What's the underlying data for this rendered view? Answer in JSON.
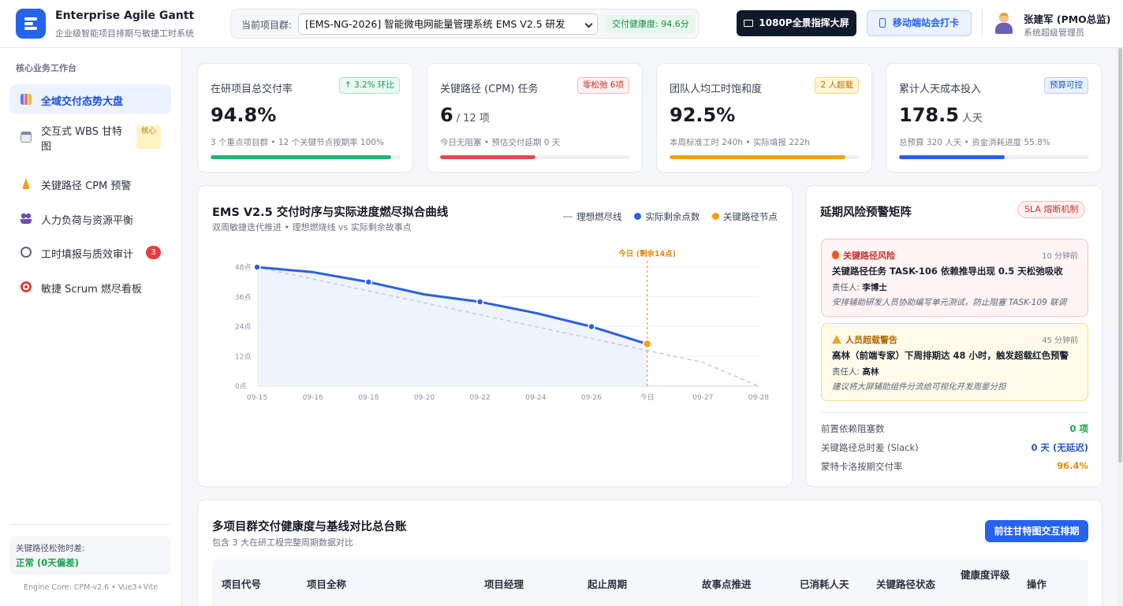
{
  "header": {
    "brand_title": "Enterprise Agile Gantt",
    "brand_subtitle": "企业级智能项目排期与敏捷工时系统",
    "project_label": "当前项目群:",
    "project_selected": "[EMS-NG-2026] 智能微电网能量管理系统 EMS V2.5 研发",
    "health_badge": "交付健康度: 94.6分",
    "bigscreen_button": "1080P全景指挥大屏",
    "mobile_button": "移动端站会打卡",
    "user_name": "张建军 (PMO总监)",
    "user_role": "系统超级管理员"
  },
  "sidebar": {
    "section_title": "核心业务工作台",
    "items": [
      {
        "label": "全域交付态势大盘",
        "active": true,
        "icon": "chart-icon"
      },
      {
        "label": "交互式 WBS 甘特图",
        "tag": "核心",
        "icon": "calendar-icon"
      },
      {
        "label": "关键路径 CPM 预警",
        "icon": "lightning-icon"
      },
      {
        "label": "人力负荷与资源平衡",
        "icon": "people-icon"
      },
      {
        "label": "工时填报与质效审计",
        "count": "3",
        "icon": "stopwatch-icon"
      },
      {
        "label": "敏捷 Scrum 燃尽看板",
        "icon": "target-icon"
      }
    ],
    "slack_label": "关键路径松弛时差:",
    "slack_value": "正常 (0天偏差)",
    "engine": "Engine Core: CPM-v2.6 • Vue3+Vite"
  },
  "kpis": [
    {
      "title": "在研项目总交付率",
      "badge": "↑ 3.2% 环比",
      "value": "94.8%",
      "unit": "",
      "note": "3 个重点项目群 • 12 个关键节点按期率 100%",
      "progress": 0.95,
      "color": "#1fb573",
      "badge_bg": "#eafaf1",
      "badge_fg": "#16915a",
      "badge_border": "#a7e5c4"
    },
    {
      "title": "关键路径 (CPM) 任务",
      "badge": "零松弛 6项",
      "value": "6",
      "unit": "/ 12 项",
      "note": "今日无阻塞 • 预估交付延期 0 天",
      "progress": 0.5,
      "color": "#e5484d",
      "badge_bg": "#fff1f1",
      "badge_fg": "#cf2d2d",
      "badge_border": "#f6b8b8"
    },
    {
      "title": "团队人均工时饱和度",
      "badge": "2 人超载",
      "value": "92.5%",
      "unit": "",
      "note": "本周标准工时 240h • 实际填报 222h",
      "progress": 0.925,
      "color": "#f2a20f",
      "badge_bg": "#fff6d6",
      "badge_fg": "#b6700a",
      "badge_border": "#f1d47c"
    },
    {
      "title": "累计人天成本投入",
      "badge": "预算可控",
      "value": "178.5",
      "unit": "人天",
      "note": "总预算 320 人天 • 资金消耗进度 55.8%",
      "progress": 0.558,
      "color": "#2563eb",
      "badge_bg": "#eaf1ff",
      "badge_fg": "#2454c9",
      "badge_border": "#b8cdf7"
    }
  ],
  "chart_card": {
    "title": "EMS V2.5 交付时序与实际进度燃尽拟合曲线",
    "subtitle": "双周敏捷迭代推进 • 理想燃烧线 vs 实际剩余故事点",
    "legend": [
      "理想燃尽线",
      "实际剩余点数",
      "关键路径节点"
    ]
  },
  "chart_data": {
    "type": "line",
    "x": [
      "09-15",
      "09-16",
      "09-18",
      "09-20",
      "09-22",
      "09-24",
      "09-26",
      "今日",
      "09-27",
      "09-28"
    ],
    "y_ticks": [
      "48点",
      "36点",
      "24点",
      "12点",
      "0点"
    ],
    "ylim": [
      0,
      48
    ],
    "series": [
      {
        "name": "理想燃尽线",
        "values": [
          48,
          43.2,
          38.4,
          33.6,
          28.8,
          24,
          19.2,
          14.4,
          9.6,
          0
        ]
      },
      {
        "name": "实际剩余点数",
        "values": [
          48,
          46,
          42,
          37,
          34,
          29.5,
          24,
          17
        ]
      }
    ],
    "milestones": [
      0,
      2,
      4,
      6
    ],
    "today_index": 7,
    "today_label": "今日 (剩余14点)",
    "colors": {
      "ideal": "#c7ccd5",
      "actual": "#2c5fe0",
      "milestone": "#f29f12"
    }
  },
  "risk": {
    "title": "延期风险预警矩阵",
    "badge": "SLA 熔断机制",
    "alerts": [
      {
        "type": "关键路径风险",
        "time": "10 分钟前",
        "title": "关键路径任务 TASK-106 依赖推导出现 0.5 天松弛吸收",
        "owner_label": "责任人: ",
        "owner": "李博士",
        "advice": "安排辅助研发人员协助编写单元测试，防止阻塞 TASK-109 联调",
        "icon": "fire-icon"
      },
      {
        "type": "人员超载警告",
        "time": "45 分钟前",
        "title": "高林（前端专家）下周排期达 48 小时，触发超载红色预警",
        "owner_label": "责任人: ",
        "owner": "高林",
        "advice": "建议将大屏辅助组件分流给可视化开发周晏分担",
        "icon": "warning-icon"
      }
    ],
    "metrics": [
      {
        "label": "前置依赖阻塞数",
        "value": "0 项",
        "color": "#16a34a"
      },
      {
        "label": "关键路径总时差 (Slack)",
        "value": "0 天 (无延迟)",
        "color": "#2454c9"
      },
      {
        "label": "蒙特卡洛按期交付率",
        "value": "96.4%",
        "color": "#e68a00"
      }
    ]
  },
  "table": {
    "title": "多项目群交付健康度与基线对比总台账",
    "subtitle": "包含 3 大在研工程完整周期数据对比",
    "goto_button": "前往甘特图交互排期",
    "headers": [
      "项目代号",
      "项目全称",
      "项目经理",
      "起止周期",
      "故事点推进",
      "已消耗人天",
      "关键路径状态",
      "健康度评级",
      "操作"
    ]
  }
}
